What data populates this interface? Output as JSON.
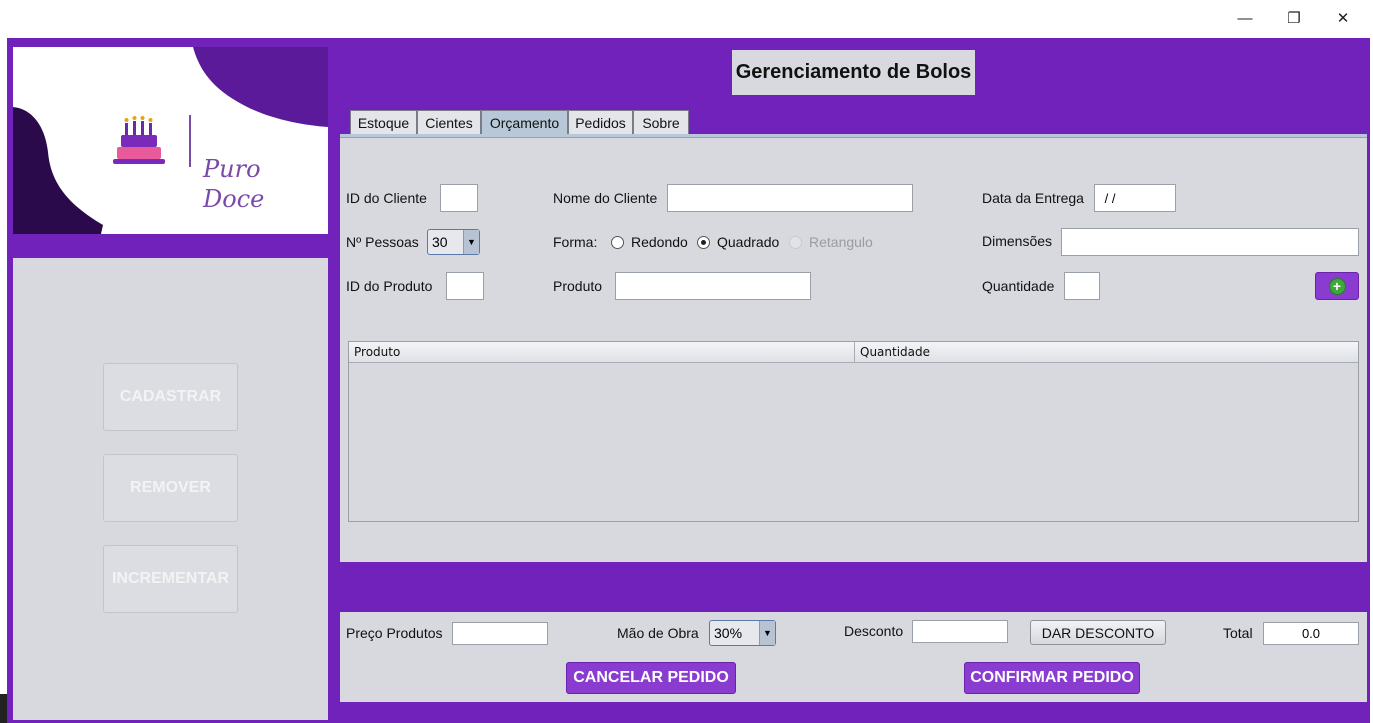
{
  "window": {
    "minimize_glyph": "—",
    "maximize_glyph": "❐",
    "close_glyph": "✕"
  },
  "logo": {
    "line1": "Puro",
    "line2": "Doce",
    "icon": "cake-icon"
  },
  "sidebar": {
    "buttons": [
      "CADASTRAR",
      "REMOVER",
      "INCREMENTAR"
    ]
  },
  "header": {
    "title": "Gerenciamento de Bolos"
  },
  "tabs": [
    "Estoque",
    "Cientes",
    "Orçamento",
    "Pedidos",
    "Sobre"
  ],
  "active_tab": "Orçamento",
  "form": {
    "client_id_label": "ID do Cliente",
    "client_id_value": "",
    "client_name_label": "Nome do Cliente",
    "client_name_value": "",
    "delivery_date_label": "Data da Entrega",
    "delivery_date_value": " / /",
    "people_label": "Nº Pessoas",
    "people_value": "30",
    "shape_label": "Forma:",
    "shape_options": [
      "Redondo",
      "Quadrado",
      "Retangulo"
    ],
    "shape_selected": "Quadrado",
    "dimensions_label": "Dimensões",
    "dimensions_value": "",
    "product_id_label": "ID do Produto",
    "product_id_value": "",
    "product_label": "Produto",
    "product_value": "",
    "quantity_label": "Quantidade",
    "quantity_value": "",
    "add_icon": "plus-circle-icon"
  },
  "table": {
    "columns": [
      "Produto",
      "Quantidade"
    ],
    "rows": []
  },
  "bottom": {
    "products_price_label": "Preço Produtos",
    "products_price_value": "",
    "labor_label": "Mão de Obra",
    "labor_value": "30%",
    "discount_label": "Desconto",
    "discount_value": "",
    "give_discount_button": "DAR DESCONTO",
    "total_label": "Total",
    "total_value": "0.0",
    "cancel_button": "CANCELAR PEDIDO",
    "confirm_button": "CONFIRMAR PEDIDO"
  },
  "colors": {
    "frame_purple": "#7122ba",
    "button_purple": "#8a3bd0",
    "panel_gray": "#d7d9df"
  }
}
